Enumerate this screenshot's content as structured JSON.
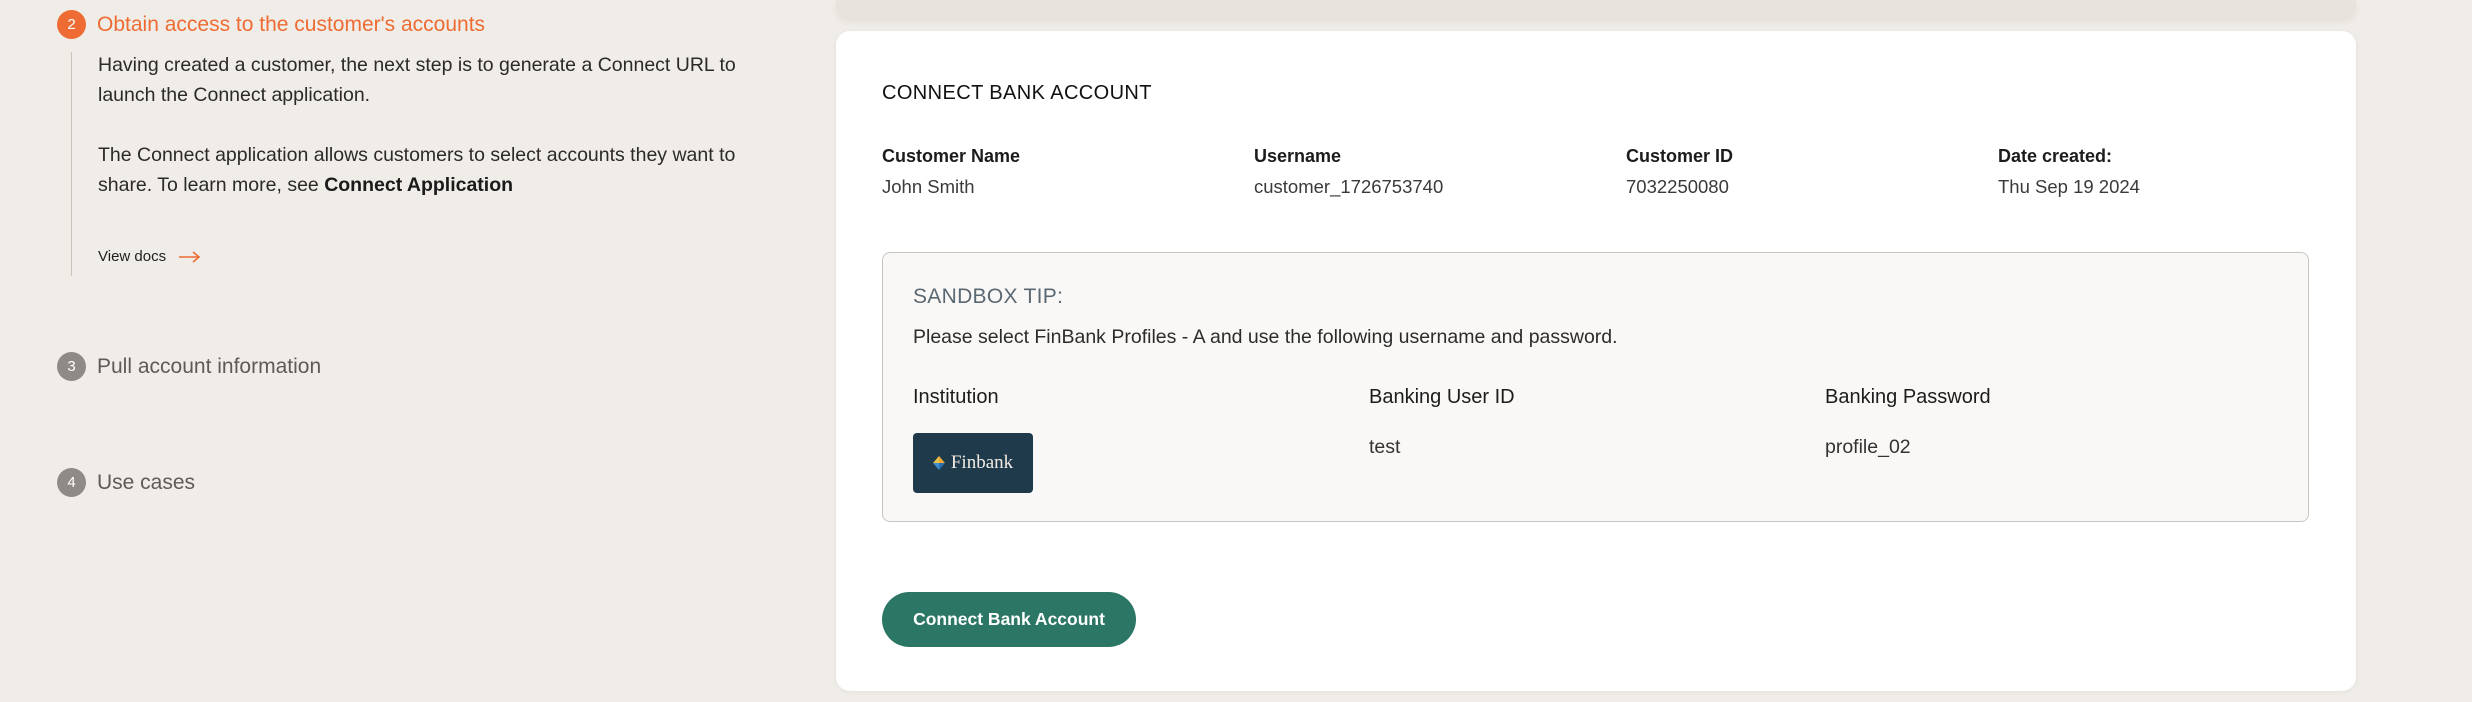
{
  "steps": [
    {
      "number": "2",
      "title": "Obtain access to the customer's accounts",
      "paragraph1": "Having created a customer, the next step is to generate a Connect URL to launch the Connect application.",
      "paragraph2_prefix": "The Connect application allows customers to select accounts they want to share. To learn more, see ",
      "paragraph2_link": "Connect Application",
      "view_docs_label": "View docs"
    },
    {
      "number": "3",
      "title": "Pull account information"
    },
    {
      "number": "4",
      "title": "Use cases"
    }
  ],
  "card": {
    "title": "CONNECT BANK ACCOUNT",
    "fields": [
      {
        "label": "Customer Name",
        "value": "John Smith"
      },
      {
        "label": "Username",
        "value": "customer_1726753740"
      },
      {
        "label": "Customer ID",
        "value": "7032250080"
      },
      {
        "label": "Date created:",
        "value": "Thu Sep 19 2024"
      }
    ],
    "sandbox_tip": {
      "heading": "SANDBOX TIP:",
      "text": "Please select FinBank Profiles - A and use the following username and password.",
      "columns": {
        "institution": "Institution",
        "user_id": "Banking User ID",
        "password": "Banking Password"
      },
      "institution_logo_text": "Finbank",
      "user_id_value": "test",
      "password_value": "profile_02"
    },
    "connect_button_label": "Connect Bank Account"
  },
  "colors": {
    "accent_orange": "#ee6c33",
    "button_green": "#2b7664",
    "background": "#f0ece7"
  }
}
